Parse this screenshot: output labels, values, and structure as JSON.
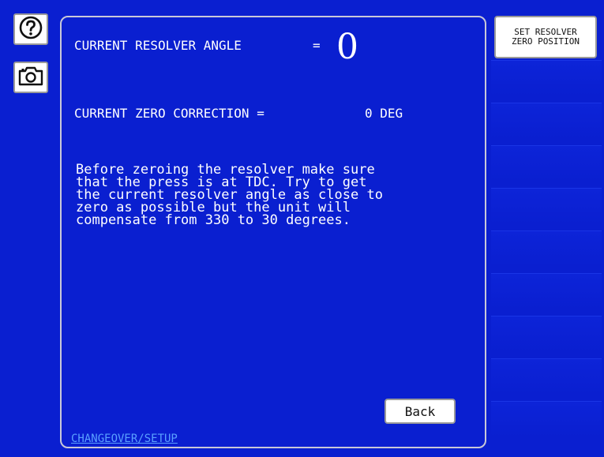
{
  "icons": {
    "help": "question-circle-icon",
    "camera": "camera-icon"
  },
  "main": {
    "angle_label": "CURRENT RESOLVER ANGLE",
    "angle_equals": "=",
    "angle_value": "0",
    "zero_label": "CURRENT ZERO CORRECTION =",
    "zero_value": "0 DEG",
    "instructions": "Before zeroing the resolver make sure\nthat the press is at TDC. Try to get\nthe current resolver angle as close to\nzero as possible but the unit will\ncompensate from 330 to 30 degrees.",
    "back_label": "Back",
    "footer": "CHANGEOVER/SETUP"
  },
  "right": {
    "set_resolver_line1": "SET RESOLVER",
    "set_resolver_line2": "ZERO POSITION"
  },
  "colors": {
    "background": "#0a1fd0",
    "text": "#ffffff",
    "footer_link": "#5aa0ff"
  }
}
